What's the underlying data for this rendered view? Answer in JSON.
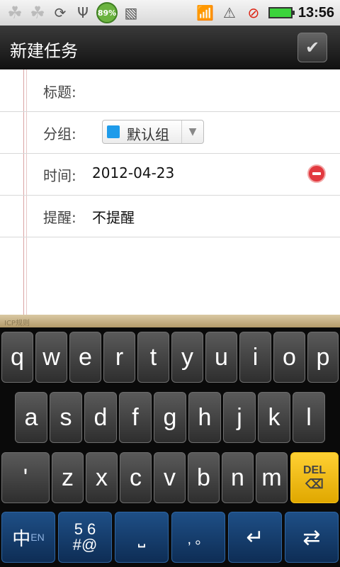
{
  "status_bar": {
    "battery_percent": "89%",
    "time": "13:56"
  },
  "header": {
    "title": "新建任务"
  },
  "form": {
    "title_label": "标题:",
    "group_label": "分组:",
    "group_value": "默认组",
    "group_color": "#1e9bea",
    "time_label": "时间:",
    "time_value": "2012-04-23",
    "reminder_label": "提醒:",
    "reminder_value": "不提醒"
  },
  "keyboard": {
    "strip_text": "ICP规则",
    "row1": [
      "q",
      "w",
      "e",
      "r",
      "t",
      "y",
      "u",
      "i",
      "o",
      "p"
    ],
    "row2": [
      "a",
      "s",
      "d",
      "f",
      "g",
      "h",
      "j",
      "k",
      "l"
    ],
    "row3": [
      "'",
      "z",
      "x",
      "c",
      "v",
      "b",
      "n",
      "m"
    ],
    "del_label": "DEL",
    "mode_label": "中",
    "mode_small": "EN",
    "numsym_top": "5 6",
    "numsym_bottom": "#@",
    "punct_label": ", 。"
  }
}
